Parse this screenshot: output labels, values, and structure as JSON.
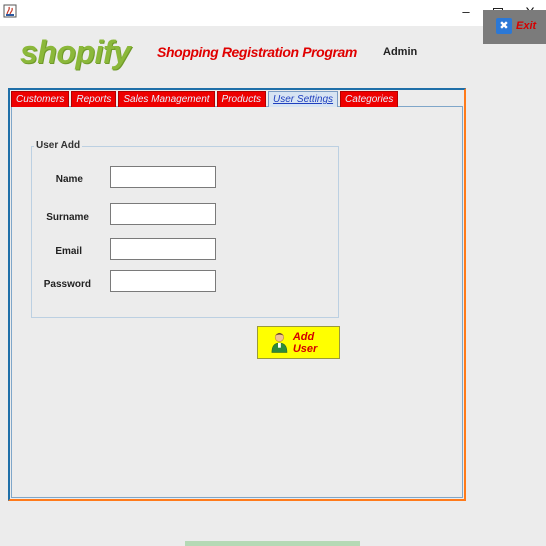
{
  "window": {
    "minimize_glyph": "–",
    "close_glyph": "X"
  },
  "header": {
    "logo": "shopify",
    "title": "Shopping Registration Program",
    "user": "Admin",
    "exit_label": "Exit",
    "exit_icon_glyph": "✖"
  },
  "tabs": [
    {
      "label": "Customers",
      "active": false
    },
    {
      "label": "Reports",
      "active": false
    },
    {
      "label": "Sales Management",
      "active": false
    },
    {
      "label": "Products",
      "active": false
    },
    {
      "label": "User Settings",
      "active": true
    },
    {
      "label": "Categories",
      "active": false
    }
  ],
  "user_add": {
    "legend": "User Add",
    "fields": [
      {
        "label": "Name",
        "value": ""
      },
      {
        "label": "Surname",
        "value": ""
      },
      {
        "label": "Email",
        "value": ""
      },
      {
        "label": "Password",
        "value": ""
      }
    ],
    "add_button": "Add User"
  },
  "colors": {
    "logo_green": "#8bb83a",
    "title_red": "#e00000",
    "tab_red": "#ee0000",
    "button_yellow": "#ffff00",
    "frame_blue": "#1f6fa8",
    "frame_orange": "#ff7a1a"
  }
}
